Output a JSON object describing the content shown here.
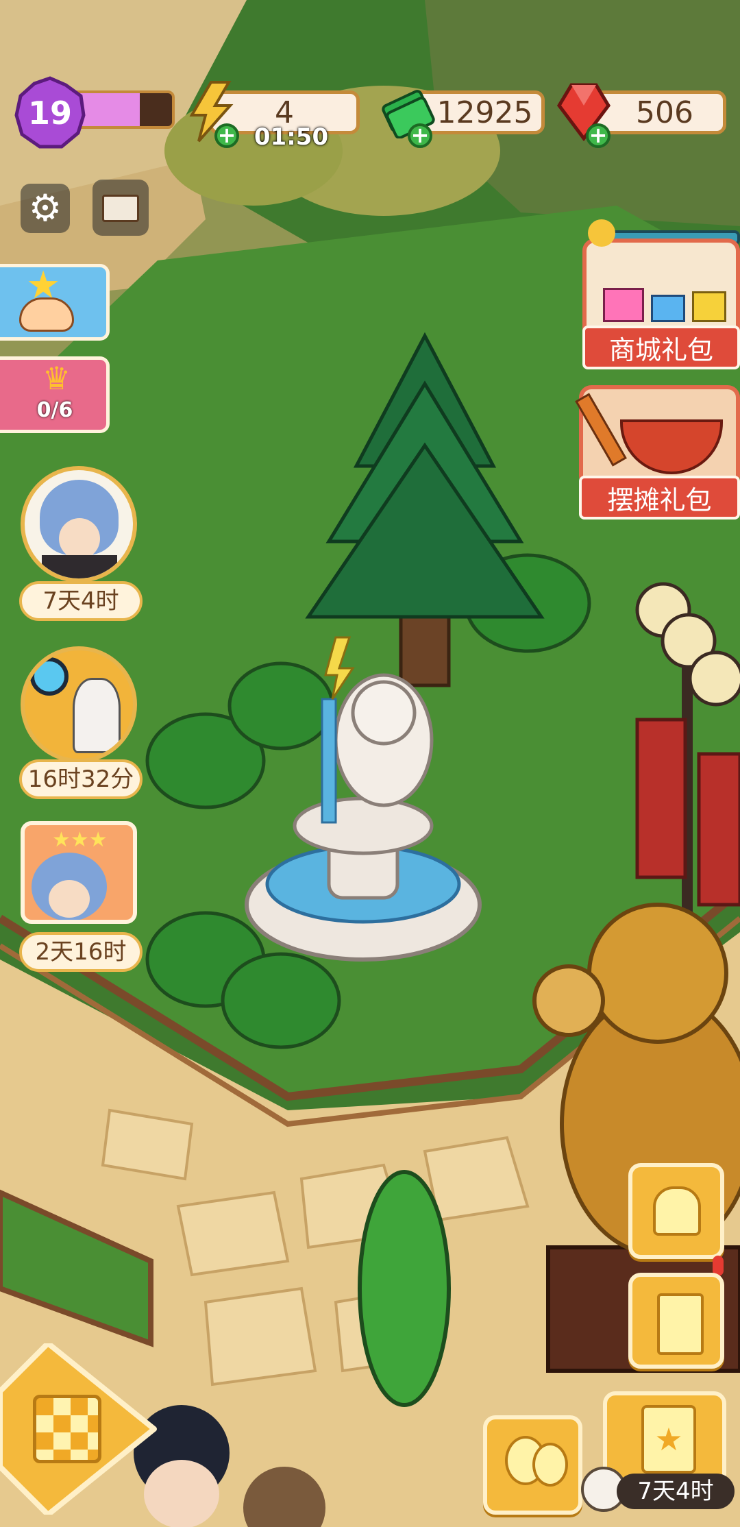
{
  "hud": {
    "level": "19",
    "level_progress": 0.7,
    "energy_value": "4",
    "energy_timer": "01:50",
    "cash_value": "12925",
    "gem_value": "506"
  },
  "left_panel": {
    "task_progress": "0/6",
    "events": [
      {
        "timer": "7天4时"
      },
      {
        "timer": "16时32分"
      },
      {
        "timer": "2天16时"
      }
    ]
  },
  "right_panel": {
    "packs": [
      {
        "label": "商城礼包"
      },
      {
        "label": "摆摊礼包"
      }
    ]
  },
  "bottom": {
    "right_timer": "7天4时"
  },
  "colors": {
    "grass": "#3f7a2e",
    "accent_gold": "#e8b54c",
    "pack_red": "#df4b3a"
  }
}
